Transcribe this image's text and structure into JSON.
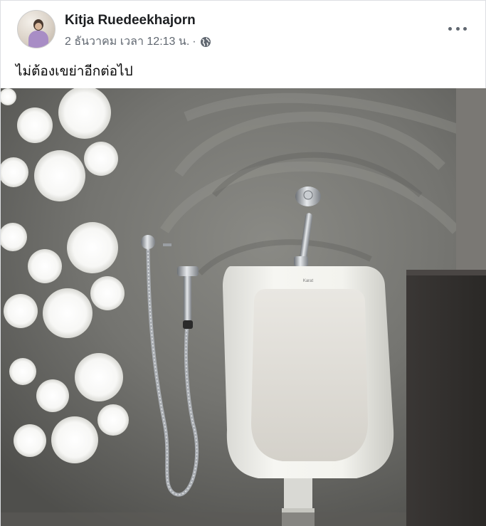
{
  "post": {
    "author_name": "Kitja Ruedeekhajorn",
    "timestamp": "2 ธันวาคม เวลา 12:13 น.",
    "separator": "·",
    "privacy_icon": "globe-icon",
    "more_icon": "more-options-icon",
    "caption": "ไม่ต้องเขย่าอีกต่อไป",
    "photo": {
      "urinal_brand": "Karat"
    }
  }
}
